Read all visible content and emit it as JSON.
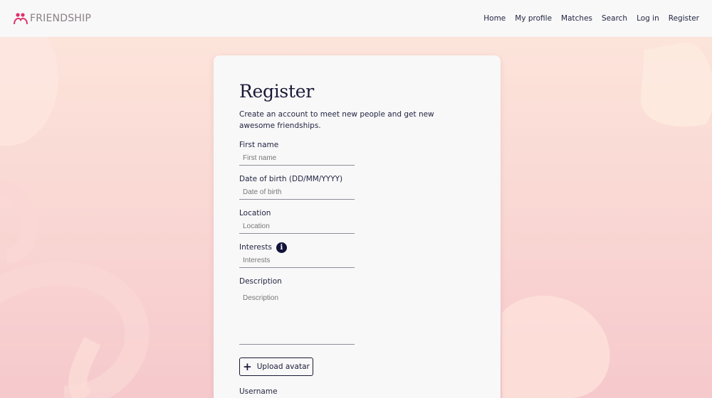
{
  "header": {
    "brand": "FRIENDSHIP",
    "nav": [
      "Home",
      "My profile",
      "Matches",
      "Search",
      "Log in",
      "Register"
    ]
  },
  "form": {
    "title": "Register",
    "intro": "Create an account to meet new people and get new awesome friendships.",
    "fields": [
      {
        "label": "First name",
        "placeholder": "First name"
      },
      {
        "label": "Date of birth (DD/MM/YYYY)",
        "placeholder": "Date of birth"
      },
      {
        "label": "Location",
        "placeholder": "Location"
      },
      {
        "label": "Interests",
        "placeholder": "Interests",
        "info_icon": "i"
      },
      {
        "label": "Description",
        "placeholder": "Description"
      }
    ],
    "upload_button": "Upload avatar",
    "upload_icon": "+",
    "username_label": "Username"
  },
  "colors": {
    "background": "#fbe3dd",
    "accent": "#e0306a",
    "text": "#1f2340",
    "card": "#f8f8f8"
  }
}
